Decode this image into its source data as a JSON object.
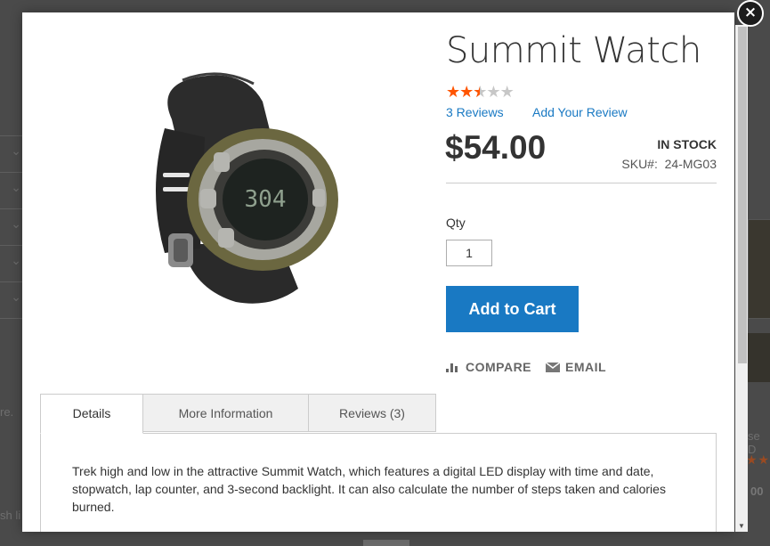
{
  "background": {
    "left_text_1": "re.",
    "left_text_2": "sh li",
    "right_text": "se D",
    "right_price_fragment": "00"
  },
  "modal": {
    "close_label": "×",
    "product": {
      "title": "Summit Watch",
      "rating": {
        "value": 2.5,
        "max": 5
      },
      "reviews_link": "3 Reviews",
      "add_review_link": "Add Your Review",
      "price": "$54.00",
      "stock_status": "IN STOCK",
      "sku_label": "SKU#:",
      "sku_value": "24-MG03",
      "qty_label": "Qty",
      "qty_value": "1",
      "add_to_cart": "Add to Cart",
      "compare": "COMPARE",
      "email": "EMAIL",
      "image_icon": "watch-image"
    },
    "tabs": [
      {
        "label": "Details",
        "active": true
      },
      {
        "label": "More Information",
        "active": false
      },
      {
        "label": "Reviews (3)",
        "active": false
      }
    ],
    "details_text": "Trek high and low in the attractive Summit Watch, which features a digital LED display with time and date, stopwatch, lap counter, and 3-second backlight. It can also calculate the number of steps taken and calories burned."
  },
  "colors": {
    "accent": "#1979c3",
    "star": "#ff5501",
    "overlay": "#4a4a4a"
  }
}
